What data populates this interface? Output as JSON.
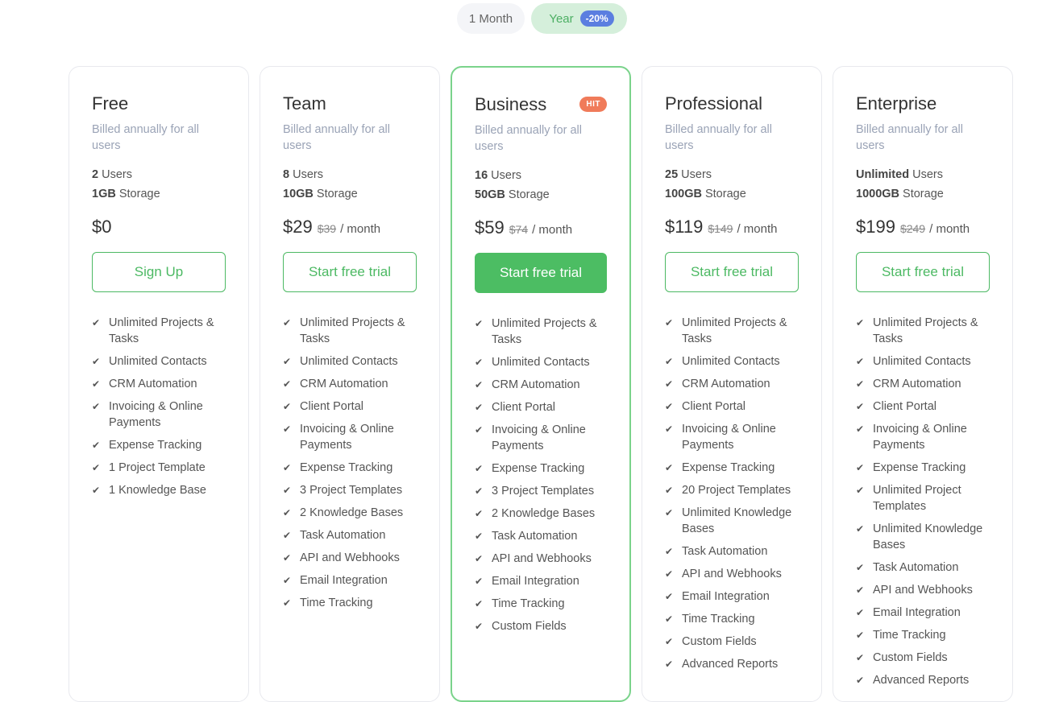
{
  "billing_toggle": {
    "month_label": "1 Month",
    "year_label": "Year",
    "discount_badge": "-20%"
  },
  "colors": {
    "accent_green": "#4cbd63",
    "featured_border": "#7ad38b",
    "discount_blue": "#5b7ee0",
    "hit_badge": "#f07b5a",
    "muted_text": "#9aa3b6"
  },
  "plans": [
    {
      "name": "Free",
      "billed": "Billed annually for all users",
      "users_value": "2",
      "users_label": "Users",
      "storage_value": "1GB",
      "storage_label": "Storage",
      "price": "$0",
      "old_price": "",
      "period": "",
      "cta": "Sign Up",
      "features": [
        "Unlimited Projects & Tasks",
        "Unlimited Contacts",
        "CRM Automation",
        "Invoicing & Online Payments",
        "Expense Tracking",
        "1 Project Template",
        "1 Knowledge Base"
      ]
    },
    {
      "name": "Team",
      "billed": "Billed annually for all users",
      "users_value": "8",
      "users_label": "Users",
      "storage_value": "10GB",
      "storage_label": "Storage",
      "price": "$29",
      "old_price": "$39",
      "period": "/ month",
      "cta": "Start free trial",
      "features": [
        "Unlimited Projects & Tasks",
        "Unlimited Contacts",
        "CRM Automation",
        "Client Portal",
        "Invoicing & Online Payments",
        "Expense Tracking",
        "3 Project Templates",
        "2 Knowledge Bases",
        "Task Automation",
        "API and Webhooks",
        "Email Integration",
        "Time Tracking"
      ]
    },
    {
      "name": "Business",
      "badge": "HIT",
      "billed": "Billed annually for all users",
      "users_value": "16",
      "users_label": "Users",
      "storage_value": "50GB",
      "storage_label": "Storage",
      "price": "$59",
      "old_price": "$74",
      "period": "/ month",
      "cta": "Start free trial",
      "features": [
        "Unlimited Projects & Tasks",
        "Unlimited Contacts",
        "CRM Automation",
        "Client Portal",
        "Invoicing & Online Payments",
        "Expense Tracking",
        "3 Project Templates",
        "2 Knowledge Bases",
        "Task Automation",
        "API and Webhooks",
        "Email Integration",
        "Time Tracking",
        "Custom Fields"
      ]
    },
    {
      "name": "Professional",
      "billed": "Billed annually for all users",
      "users_value": "25",
      "users_label": "Users",
      "storage_value": "100GB",
      "storage_label": "Storage",
      "price": "$119",
      "old_price": "$149",
      "period": "/ month",
      "cta": "Start free trial",
      "features": [
        "Unlimited Projects & Tasks",
        "Unlimited Contacts",
        "CRM Automation",
        "Client Portal",
        "Invoicing & Online Payments",
        "Expense Tracking",
        "20 Project Templates",
        "Unlimited Knowledge Bases",
        "Task Automation",
        "API and Webhooks",
        "Email Integration",
        "Time Tracking",
        "Custom Fields",
        "Advanced Reports"
      ]
    },
    {
      "name": "Enterprise",
      "billed": "Billed annually for all users",
      "users_value": "Unlimited",
      "users_label": "Users",
      "storage_value": "1000GB",
      "storage_label": "Storage",
      "price": "$199",
      "old_price": "$249",
      "period": "/ month",
      "cta": "Start free trial",
      "features": [
        "Unlimited Projects & Tasks",
        "Unlimited Contacts",
        "CRM Automation",
        "Client Portal",
        "Invoicing & Online Payments",
        "Expense Tracking",
        "Unlimited Project Templates",
        "Unlimited Knowledge Bases",
        "Task Automation",
        "API and Webhooks",
        "Email Integration",
        "Time Tracking",
        "Custom Fields",
        "Advanced Reports"
      ]
    }
  ]
}
